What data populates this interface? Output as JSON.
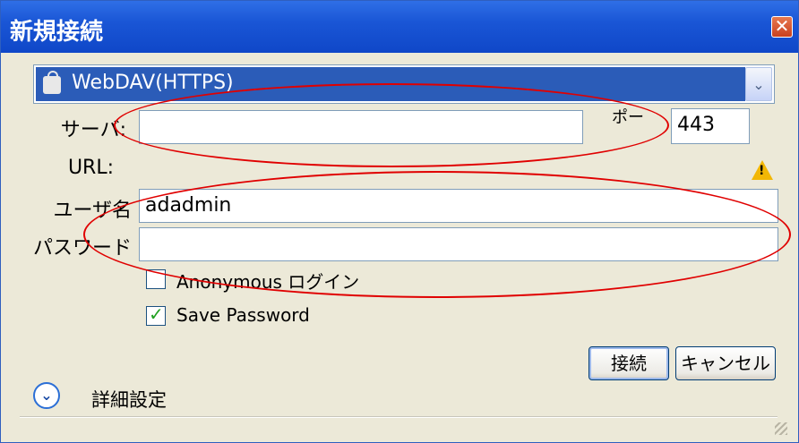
{
  "window": {
    "title": "新規接続",
    "close_glyph": "✕"
  },
  "protocol": {
    "icon": "lock-icon",
    "value": "WebDAV(HTTPS)",
    "dropdown_glyph": "⌄"
  },
  "server": {
    "label": "サーバ:",
    "value": ""
  },
  "port": {
    "label": "ポー",
    "value": "443"
  },
  "url": {
    "label": "URL:",
    "warning_glyph": "!"
  },
  "username": {
    "label": "ユーザ名",
    "value": "adadmin"
  },
  "password": {
    "label": "パスワード",
    "value": ""
  },
  "anonymous": {
    "label": "Anonymous ログイン",
    "checked": false
  },
  "save_password": {
    "label": "Save Password",
    "checked": true,
    "check_glyph": "✓"
  },
  "buttons": {
    "connect": "接続",
    "cancel": "キャンセル"
  },
  "advanced": {
    "label": "詳細設定",
    "toggle_glyph": "⌄"
  },
  "colors": {
    "titlebar": "#1a56d6",
    "selection": "#2b5cb8",
    "annotation": "#e00000",
    "dialog_bg": "#ece9d8"
  }
}
